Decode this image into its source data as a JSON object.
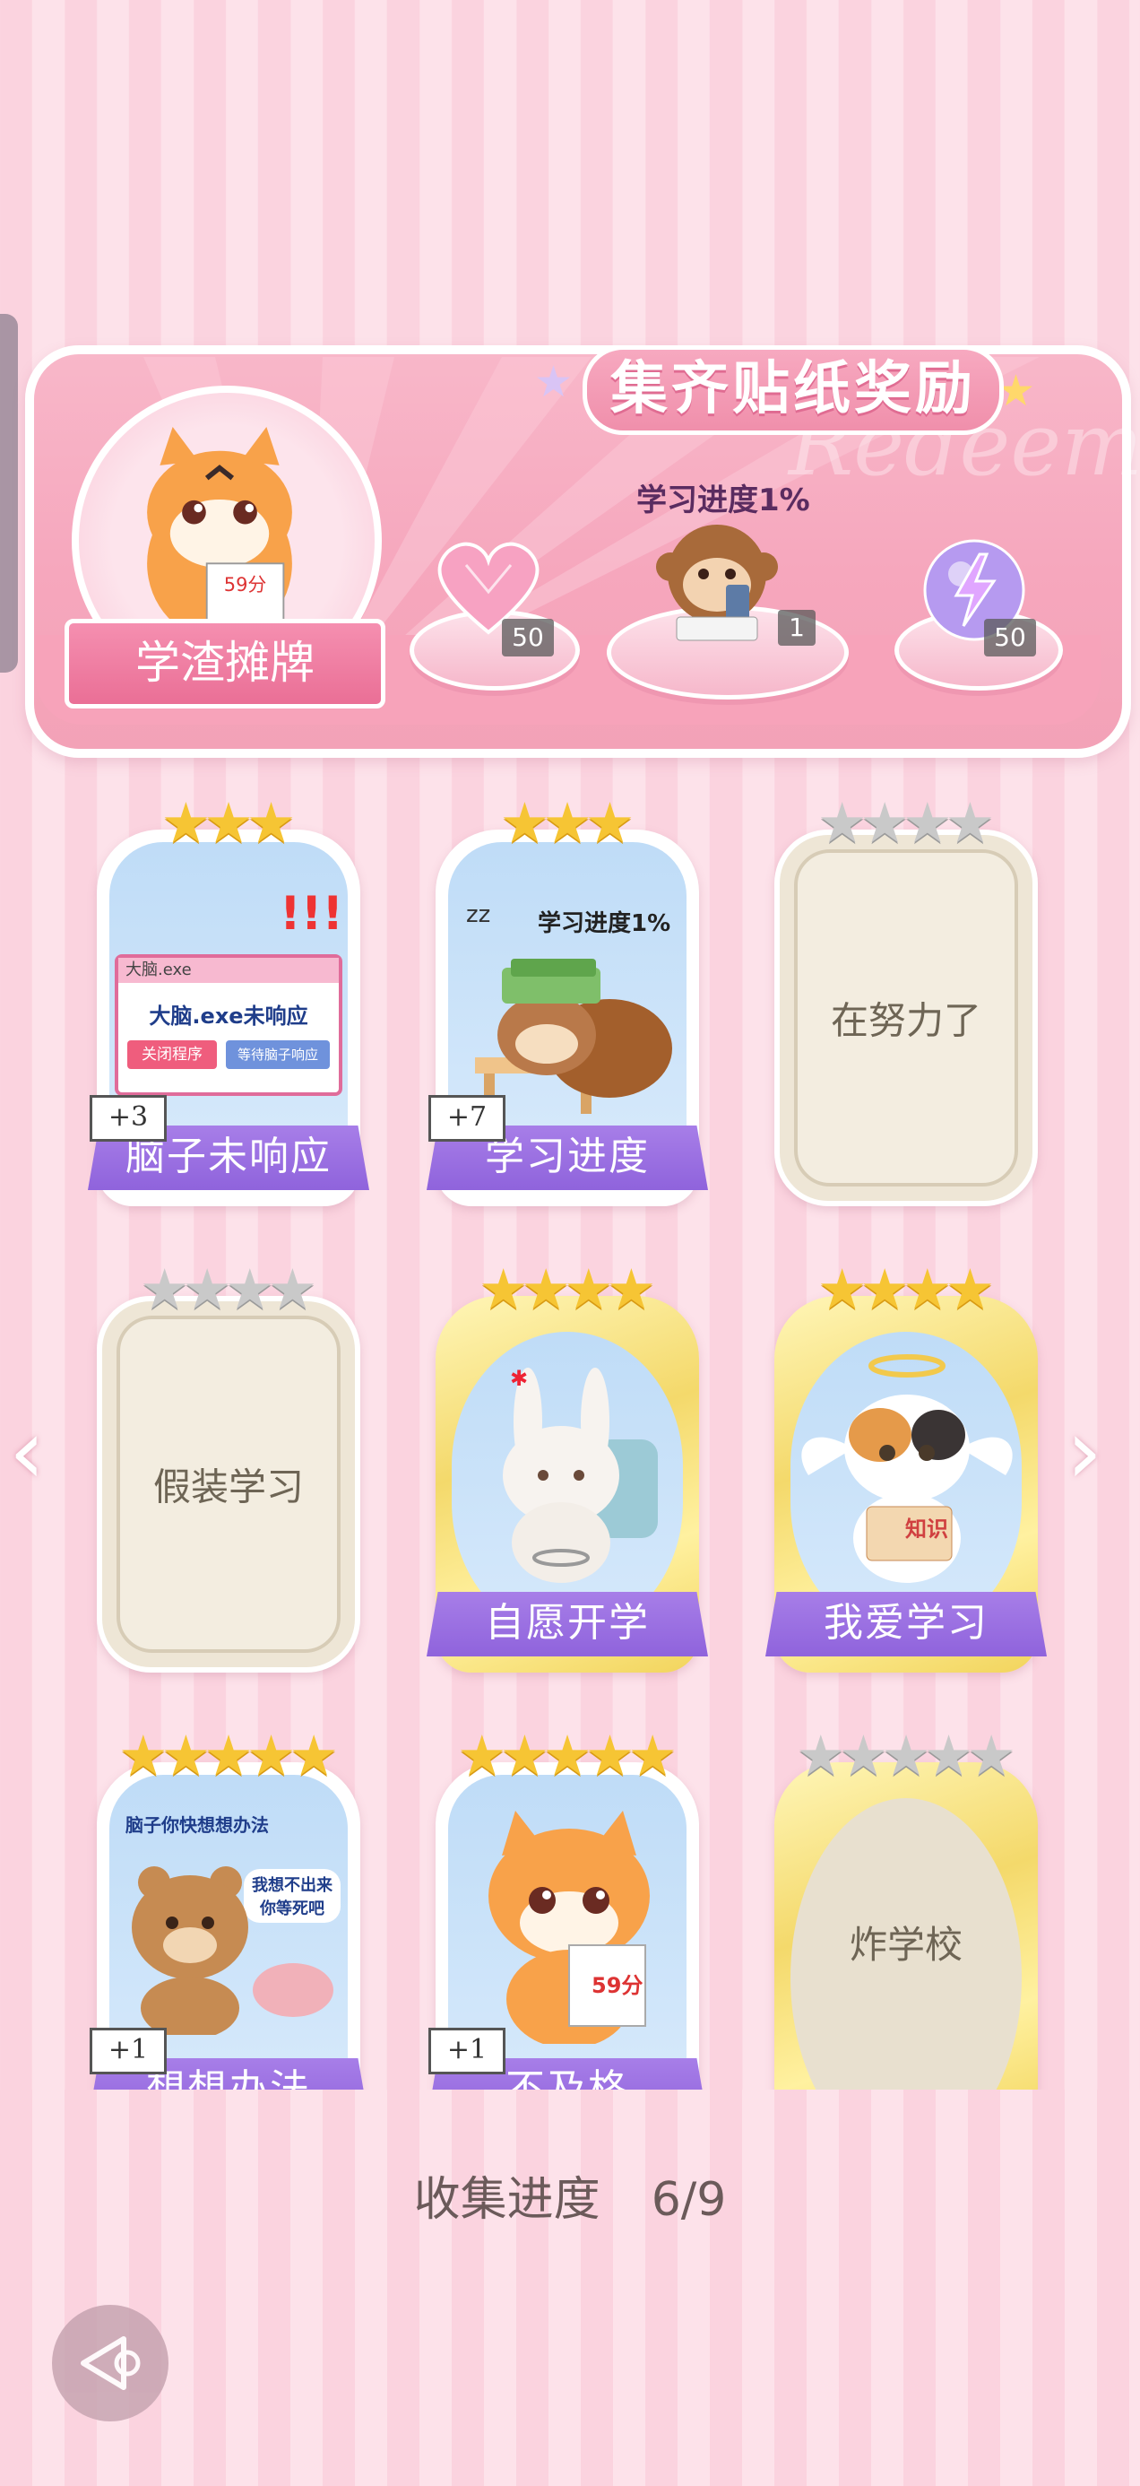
{
  "reward": {
    "title": "集齐贴纸奖励",
    "watermark": "Redeem",
    "avatar_label": "学渣摊牌",
    "avatar_score": "59分",
    "progress_text": "学习进度1%",
    "items": [
      {
        "icon": "heart-gem-icon",
        "count": "50"
      },
      {
        "icon": "monkey-phone-icon",
        "count": "1"
      },
      {
        "icon": "lightning-orb-icon",
        "count": "50"
      }
    ]
  },
  "cards": [
    {
      "label": "脑子未响应",
      "plus": "+3",
      "stars": 3,
      "total": 3,
      "state": "owned",
      "art": {
        "title": "大脑.exe",
        "msg": "大脑.exe未响应",
        "btn1": "关闭程序",
        "btn2": "等待脑子响应"
      }
    },
    {
      "label": "学习进度",
      "plus": "+7",
      "stars": 3,
      "total": 3,
      "state": "owned",
      "art": {
        "caption": "学习进度1%",
        "zz": "zz"
      }
    },
    {
      "label": "在努力了",
      "stars": 0,
      "total": 4,
      "state": "locked"
    },
    {
      "label": "假装学习",
      "stars": 0,
      "total": 4,
      "state": "locked"
    },
    {
      "label": "自愿开学",
      "stars": 4,
      "total": 4,
      "state": "gold"
    },
    {
      "label": "我爱学习",
      "stars": 4,
      "total": 4,
      "state": "gold",
      "art": {
        "book": "知识"
      }
    },
    {
      "label": "想想办法",
      "plus": "+1",
      "stars": 5,
      "total": 5,
      "state": "owned",
      "art": {
        "bubble1": "脑子你快想想办法",
        "bubble2": "我想不出来你等死吧"
      }
    },
    {
      "label": "不及格",
      "plus": "+1",
      "stars": 5,
      "total": 5,
      "state": "owned",
      "art": {
        "score": "59分"
      }
    },
    {
      "label": "炸学校",
      "stars": 0,
      "total": 5,
      "state": "oval"
    }
  ],
  "collection": {
    "label": "收集进度",
    "value": "6/9"
  },
  "nav": {
    "left": "‹",
    "right": "›"
  }
}
